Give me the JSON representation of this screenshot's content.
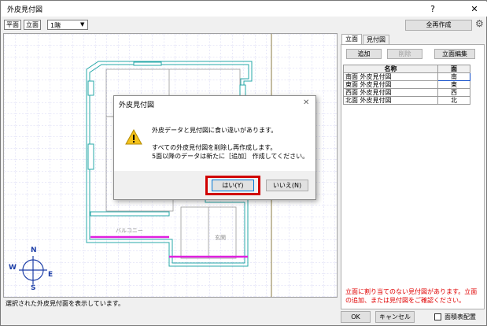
{
  "window": {
    "title": "外皮見付図",
    "help": "?",
    "close": "✕"
  },
  "toolbar": {
    "view_plan": "平面",
    "view_elevation": "立面",
    "floor_value": "1階",
    "regenerate_all": "全再作成"
  },
  "canvas": {
    "label_balcony": "バルコニー",
    "label_entrance": "玄関",
    "compass": {
      "n": "N",
      "s": "S",
      "e": "E",
      "w": "W"
    }
  },
  "status_text": "選択された外皮見付面を表示しています。",
  "right_panel": {
    "tabs": [
      "立面",
      "見付図"
    ],
    "add": "追加",
    "delete": "削除",
    "edit_elevation": "立面編集",
    "columns": [
      "名称",
      "面"
    ],
    "rows": [
      {
        "name": "南面 外皮見付図",
        "face": "南"
      },
      {
        "name": "東面 外皮見付図",
        "face": "東"
      },
      {
        "name": "西面 外皮見付図",
        "face": "西"
      },
      {
        "name": "北面 外皮見付図",
        "face": "北"
      }
    ],
    "warning": "立面に割り当てのない見付図があります。立面の追加、または見付図をご確認ください。"
  },
  "footer": {
    "ok": "OK",
    "cancel": "キャンセル",
    "area_table_checkbox": "面積表配置"
  },
  "dialog": {
    "title": "外皮見付図",
    "close": "✕",
    "line1": "外皮データと見付図に食い違いがあります。",
    "line2": "すべての外皮見付図を削除し再作成します。",
    "line3": "5面以降のデータは新たに［追加］ 作成してください。",
    "yes": "はい(Y)",
    "no": "いいえ(N)"
  },
  "colors": {
    "grid": "#c8c8f0",
    "wall_outline": "#27a8a8",
    "balcony_line": "#e020e0",
    "highlight_frame": "#d00000",
    "warning_icon": "#f4c21b"
  }
}
